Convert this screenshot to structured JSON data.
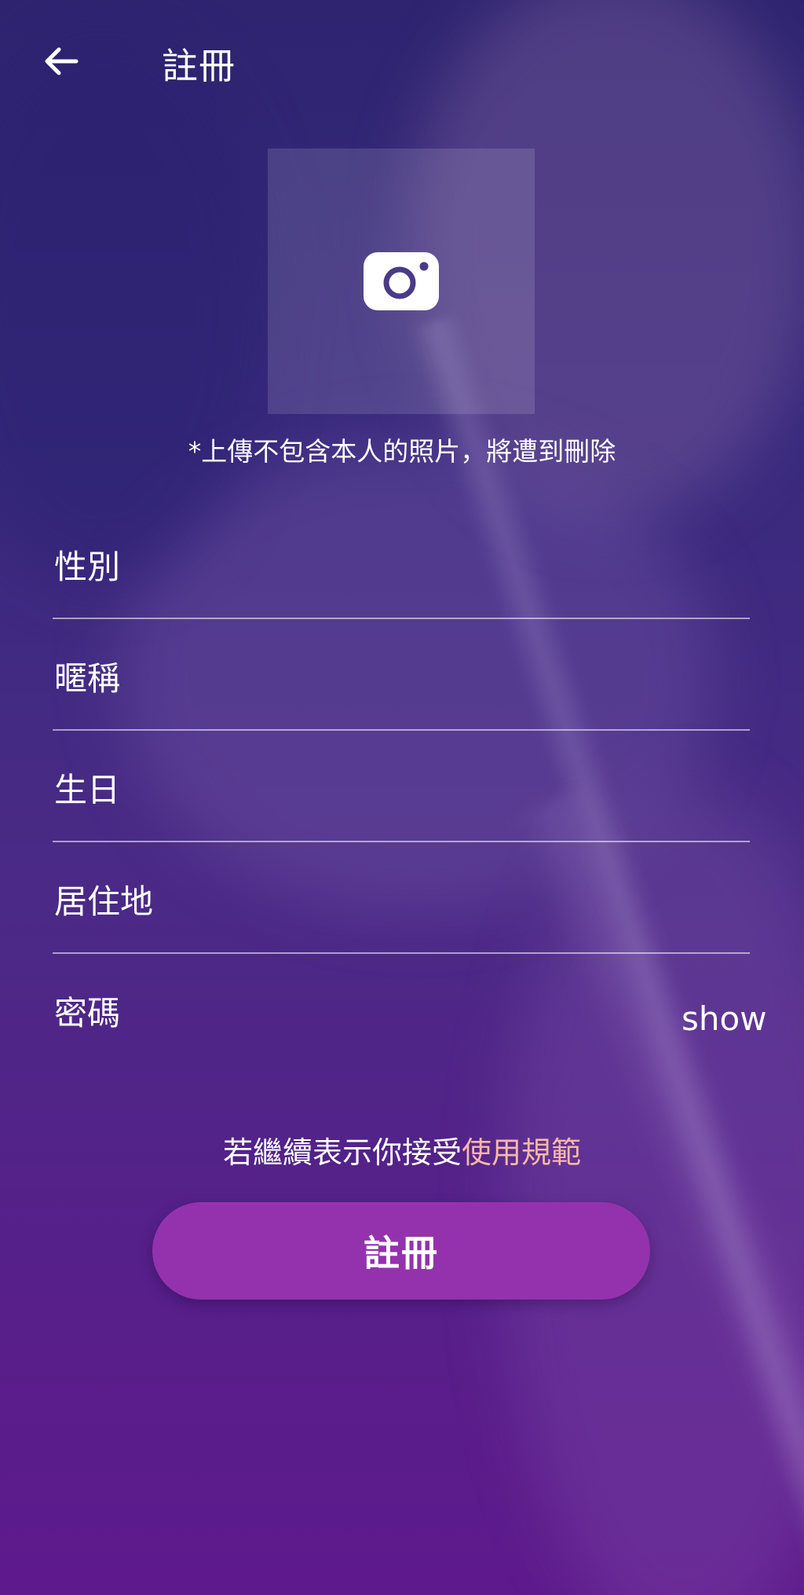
{
  "header": {
    "title": "註冊",
    "back_icon": "arrow-left-icon"
  },
  "photo": {
    "icon": "camera-icon",
    "notice": "*上傳不包含本人的照片，將遭到刪除"
  },
  "form": {
    "fields": [
      {
        "label": "性別"
      },
      {
        "label": "暱稱"
      },
      {
        "label": "生日"
      },
      {
        "label": "居住地"
      },
      {
        "label": "密碼"
      }
    ],
    "show_label": "show"
  },
  "terms": {
    "prefix": "若繼續表示你接受",
    "link": "使用規範"
  },
  "submit": {
    "label": "註冊"
  },
  "colors": {
    "accent_button": "#9432ad",
    "terms_link": "#f6b8a6",
    "background_top": "#2e2470",
    "background_bottom": "#5e1a8c"
  }
}
